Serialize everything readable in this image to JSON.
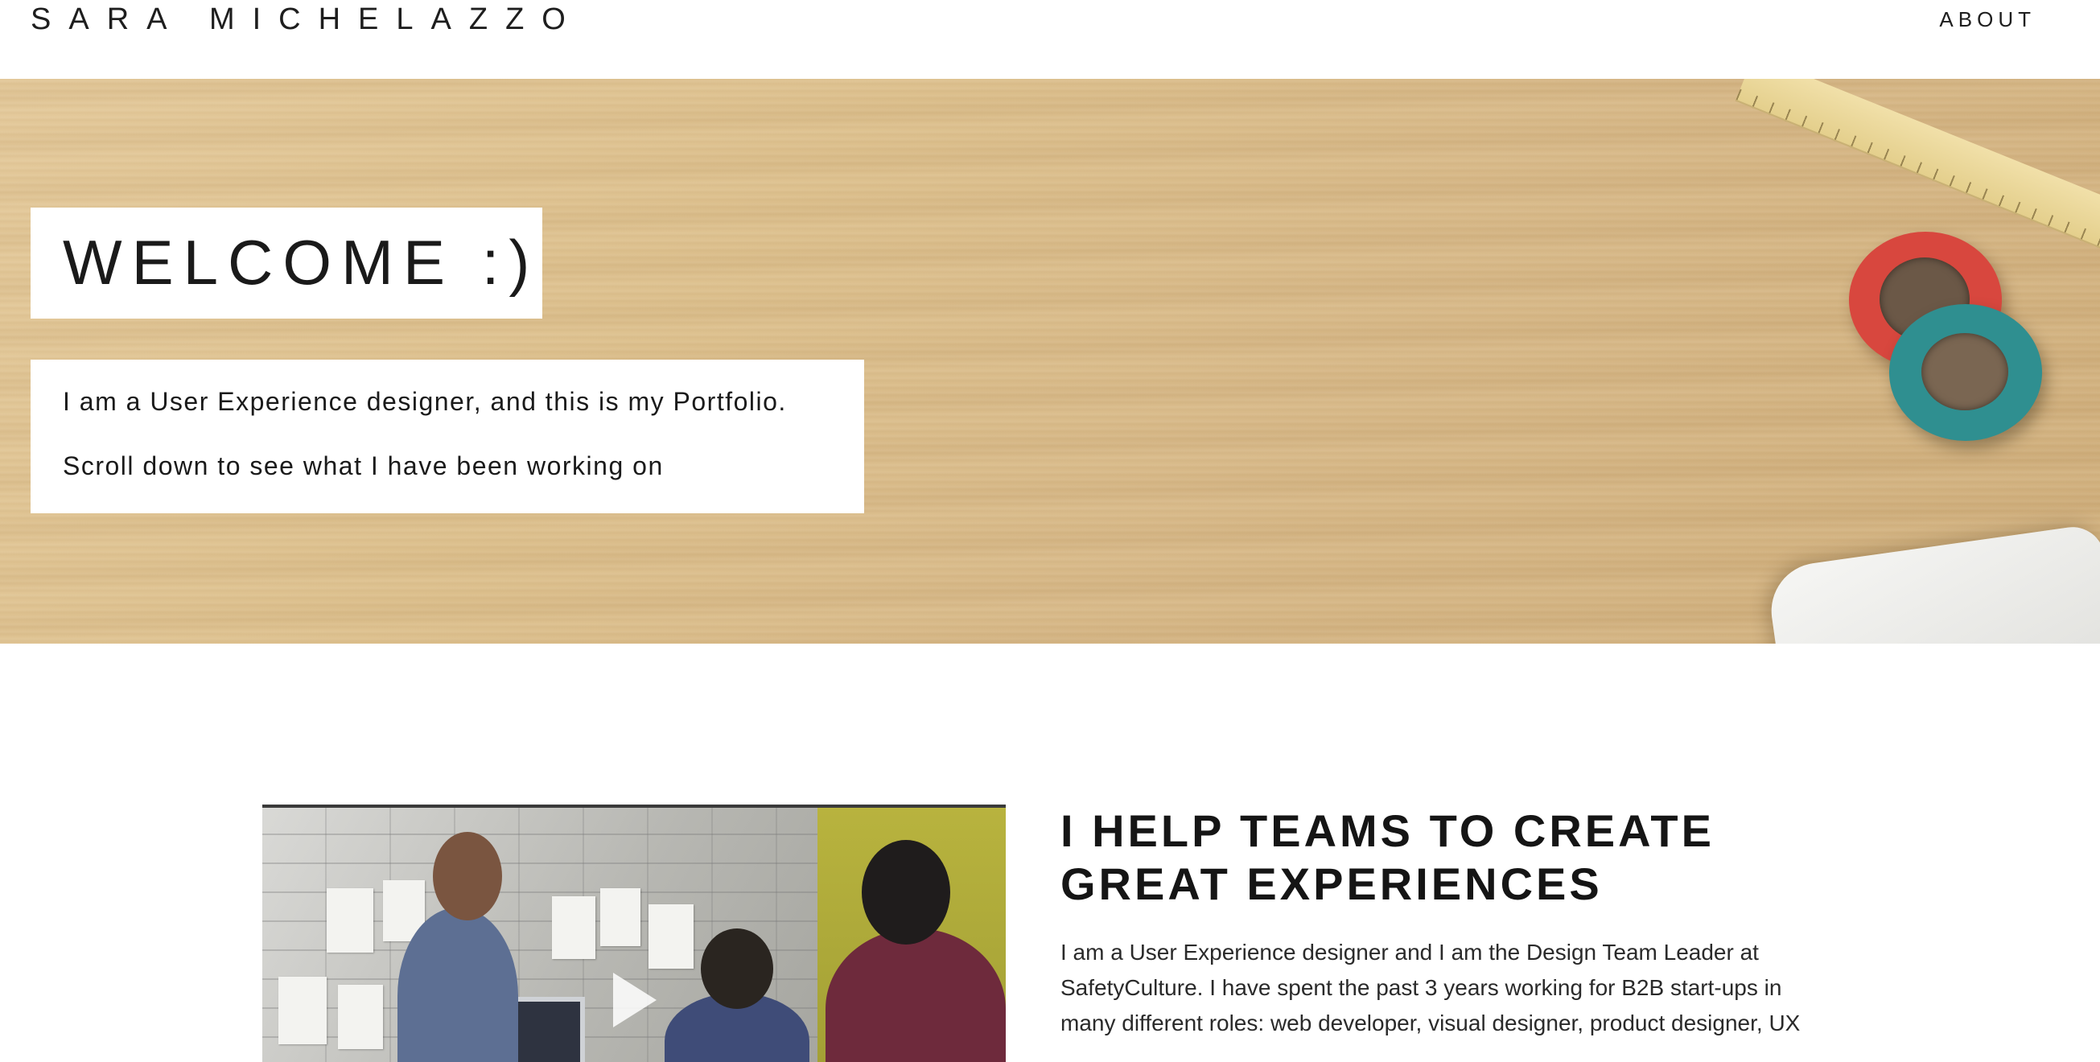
{
  "header": {
    "site_title": "SARA MICHELAZZO",
    "nav_about": "ABOUT"
  },
  "hero": {
    "welcome": "WELCOME :)",
    "intro_line_1": "I am a User Experience designer, and this is my Portfolio.",
    "intro_line_2": "Scroll down to see what I have been working on"
  },
  "intro_section": {
    "heading_line_1": "I HELP TEAMS TO CREATE",
    "heading_line_2": "GREAT EXPERIENCES",
    "body_lines": [
      "I am a User Experience designer and I am the Design Team Leader at",
      "SafetyCulture. I have spent the past 3 years working for B2B start-ups in",
      "many different roles: web developer, visual designer, product designer, UX"
    ],
    "video_icon": "play-icon"
  },
  "colors": {
    "accent_text": "#1a1a1a",
    "hero_wood": "#dcbf8c",
    "tape_red": "#d8473e",
    "tape_teal": "#2f8f90"
  }
}
